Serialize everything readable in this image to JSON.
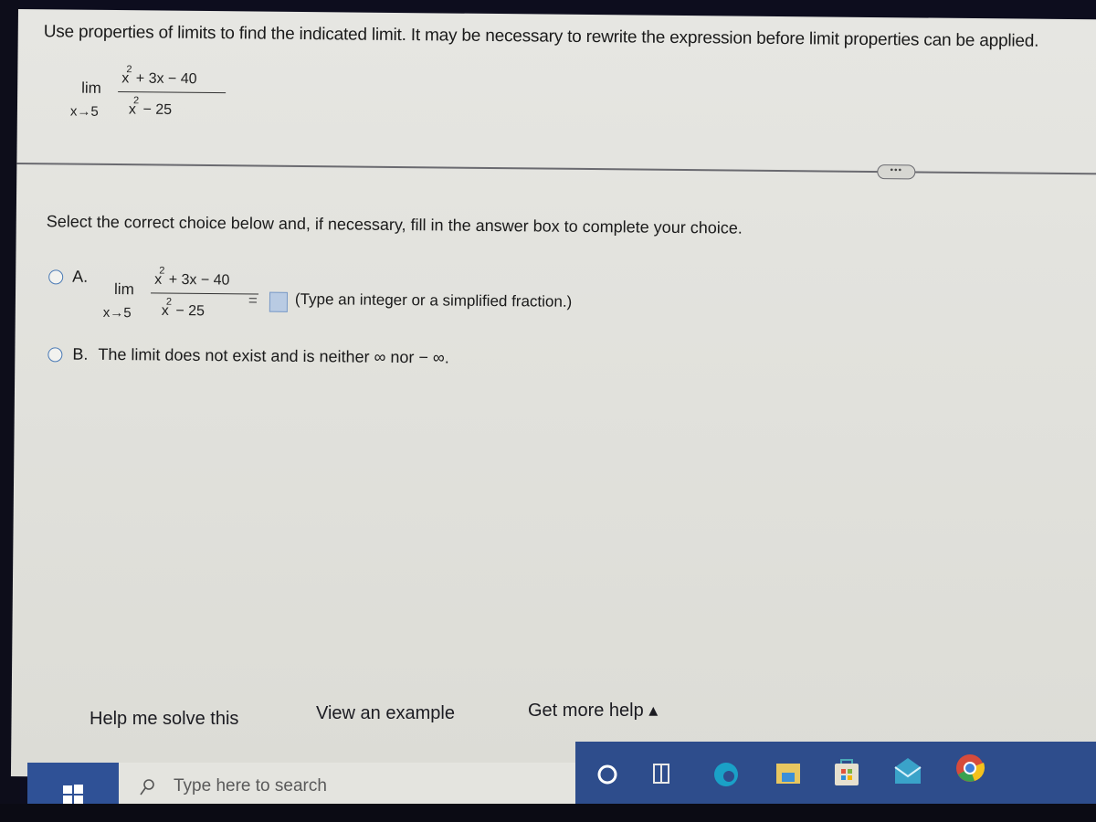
{
  "question": {
    "instruction": "Use properties of limits to find the indicated limit. It may be necessary to rewrite the expression before limit properties can be applied.",
    "limit": {
      "lim_label": "lim",
      "approach": "x→5",
      "numerator_base": "x",
      "numerator_exp": "2",
      "numerator_rest": " + 3x − 40",
      "denominator_base": "x",
      "denominator_exp": "2",
      "denominator_rest": " − 25"
    }
  },
  "more_button_label": "•••",
  "prompt": "Select the correct choice below and, if necessary,  fill in the answer box to complete your choice.",
  "choices": [
    {
      "letter": "A.",
      "equals": "=",
      "answer_value": "",
      "hint": "(Type an integer or a simplified fraction.)"
    },
    {
      "letter": "B.",
      "text": "The limit does not exist and is neither ∞ nor − ∞."
    }
  ],
  "help_links": {
    "solve": "Help me solve this",
    "example": "View an example",
    "more": "Get more help ▴"
  },
  "taskbar": {
    "search_placeholder": "Type here to search",
    "icons": [
      "windows-start-icon",
      "cortana-icon",
      "task-view-icon",
      "edge-icon",
      "file-explorer-icon",
      "store-icon",
      "mail-icon",
      "chrome-icon"
    ]
  }
}
